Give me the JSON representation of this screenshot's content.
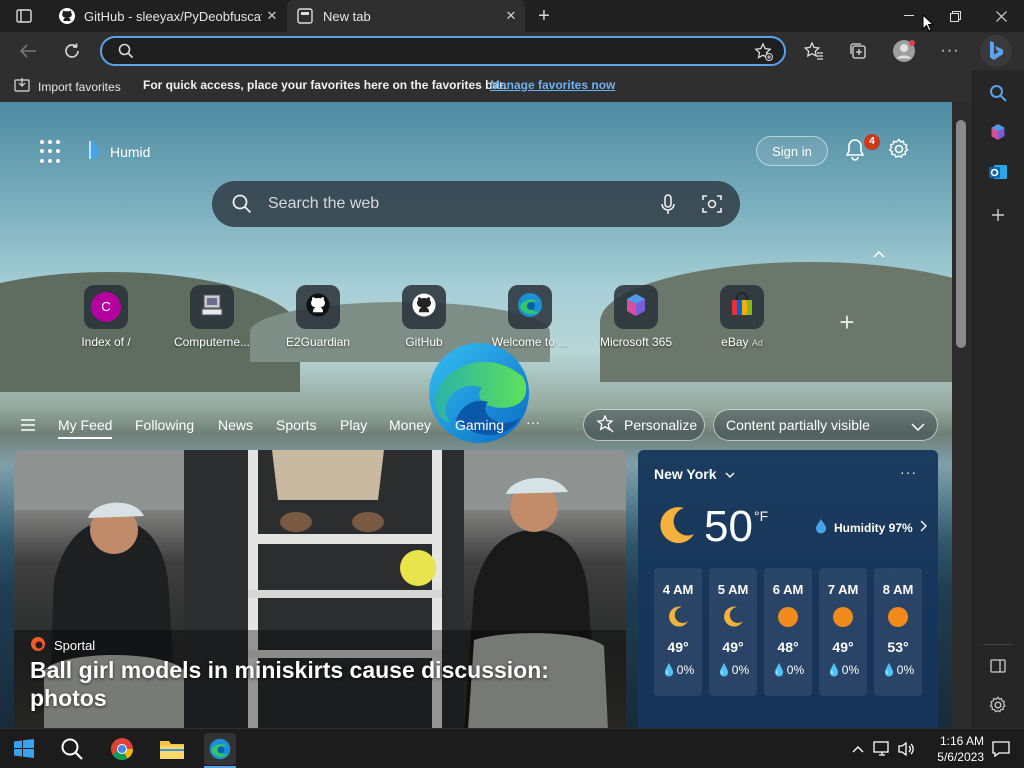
{
  "tabs": [
    {
      "title": "GitHub - sleeyax/PyDeobfuscator",
      "favicon": "github-icon",
      "active": false
    },
    {
      "title": "New tab",
      "favicon": "newtab-icon",
      "active": true
    }
  ],
  "window_controls": {
    "minimize": "minimize-icon",
    "restore": "restore-icon",
    "close": "close-icon"
  },
  "address_bar": {
    "value": "",
    "placeholder": ""
  },
  "favorites_bar": {
    "import_label": "Import favorites",
    "tip": "For quick access, place your favorites here on the favorites bar.",
    "manage_link": "Manage favorites now"
  },
  "newtab": {
    "weather_mini": "Humid",
    "signin_label": "Sign in",
    "notification_count": "4",
    "search_placeholder": "Search the web",
    "quick_links": [
      {
        "label": "Index of /",
        "icon": "letter-c-icon",
        "letter": "C",
        "color": "#b4009e"
      },
      {
        "label": "Computerne...",
        "icon": "computer-icon"
      },
      {
        "label": "E2Guardian",
        "icon": "github-icon"
      },
      {
        "label": "GitHub",
        "icon": "github-icon"
      },
      {
        "label": "Welcome to ...",
        "icon": "edge-icon"
      },
      {
        "label": "Microsoft 365",
        "icon": "m365-icon"
      },
      {
        "label": "eBay",
        "ad": "Ad",
        "icon": "ebay-bag-icon"
      }
    ],
    "feed_tabs": [
      "My Feed",
      "Following",
      "News",
      "Sports",
      "Play",
      "Money",
      "Gaming"
    ],
    "feed_more": "···",
    "personalize_label": "Personalize",
    "visibility_label": "Content partially visible"
  },
  "hero": {
    "source": "Sportal",
    "headline": "Ball girl models in miniskirts cause discussion: photos"
  },
  "weather": {
    "city": "New York",
    "temp": "50",
    "unit": "°F",
    "humidity": "Humidity 97%",
    "hours": [
      {
        "time": "4 AM",
        "icon": "moon-icon",
        "temp": "49°",
        "precip": "0%"
      },
      {
        "time": "5 AM",
        "icon": "moon-icon",
        "temp": "49°",
        "precip": "0%"
      },
      {
        "time": "6 AM",
        "icon": "sun-icon",
        "temp": "48°",
        "precip": "0%"
      },
      {
        "time": "7 AM",
        "icon": "sun-icon",
        "temp": "49°",
        "precip": "0%"
      },
      {
        "time": "8 AM",
        "icon": "sun-icon",
        "temp": "53°",
        "precip": "0%"
      }
    ]
  },
  "taskbar": {
    "time": "1:16 AM",
    "date": "5/6/2023"
  },
  "colors": {
    "accent": "#5aa3ea",
    "link": "#6db3f2",
    "badge": "#c93b1b",
    "sun": "#f08a1c",
    "moon": "#f4b23c"
  }
}
